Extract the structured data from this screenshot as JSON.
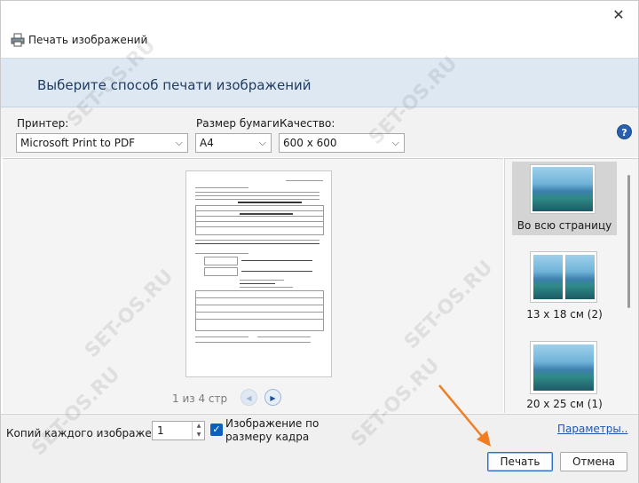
{
  "window": {
    "title": "Печать изображений",
    "close_glyph": "✕"
  },
  "banner": {
    "heading": "Выберите способ печати изображений"
  },
  "options": {
    "printer_label": "Принтер:",
    "printer_value": "Microsoft Print to PDF",
    "paper_label": "Размер бумаги:",
    "paper_value": "A4",
    "quality_label": "Качество:",
    "quality_value": "600 x 600",
    "help_glyph": "?"
  },
  "preview": {
    "pager_text": "1 из 4 стр"
  },
  "layouts": [
    {
      "label": "Во всю страницу",
      "selected": true
    },
    {
      "label": "13 x 18 см (2)",
      "selected": false
    },
    {
      "label": "20 x 25 см (1)",
      "selected": false
    }
  ],
  "bottom": {
    "copies_label": "Копий каждого изображения:",
    "copies_value": "1",
    "fit_label": "Изображение по размеру кадра",
    "fit_checked": true,
    "params_link": "Параметры..",
    "print_button": "Печать",
    "cancel_button": "Отмена"
  },
  "colors": {
    "banner_bg": "#dde8f3",
    "accent": "#0b5fbf",
    "arrow": "#f07f24"
  },
  "watermarks": [
    "SET-OS.RU",
    "SET-OS.RU",
    "SET-OS.RU",
    "SET-OS.RU",
    "SET-OS.RU",
    "SET-OS.RU"
  ]
}
